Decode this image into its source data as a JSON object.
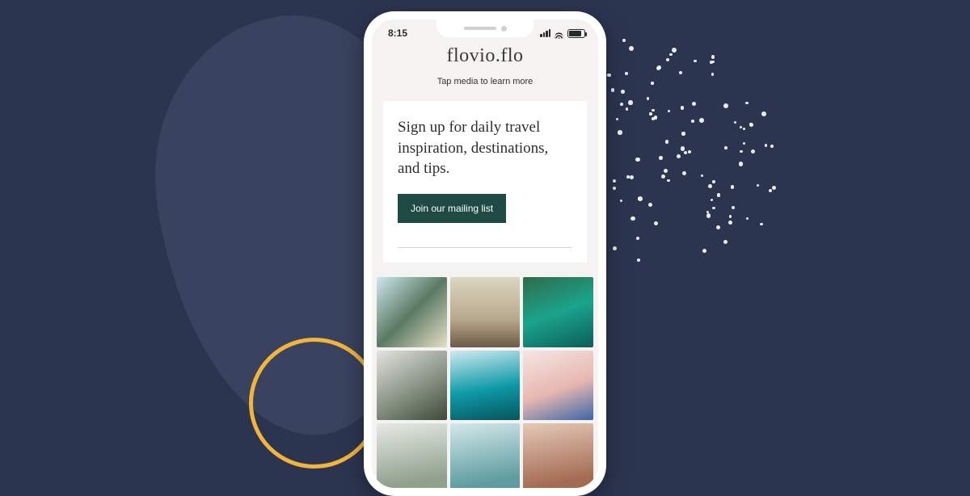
{
  "statusbar": {
    "time": "8:15"
  },
  "header": {
    "brand": "flovio.flo",
    "subtitle": "Tap media to learn more"
  },
  "card": {
    "heading": "Sign up for daily travel inspiration, destinations, and tips.",
    "cta_label": "Join our mailing list"
  },
  "grid": {
    "tiles": [
      {
        "alt": "bridge-in-mountains"
      },
      {
        "alt": "woman-at-plaza"
      },
      {
        "alt": "tropical-beach-palms"
      },
      {
        "alt": "hikers-group"
      },
      {
        "alt": "turquoise-lake"
      },
      {
        "alt": "santorini-white-buildings"
      },
      {
        "alt": "path"
      },
      {
        "alt": "coastal-town"
      },
      {
        "alt": "photographer"
      }
    ]
  },
  "colors": {
    "page_bg": "#2c3550",
    "blob": "#39425e",
    "ring": "#f2b43a",
    "cta_bg": "#1f4a43"
  }
}
